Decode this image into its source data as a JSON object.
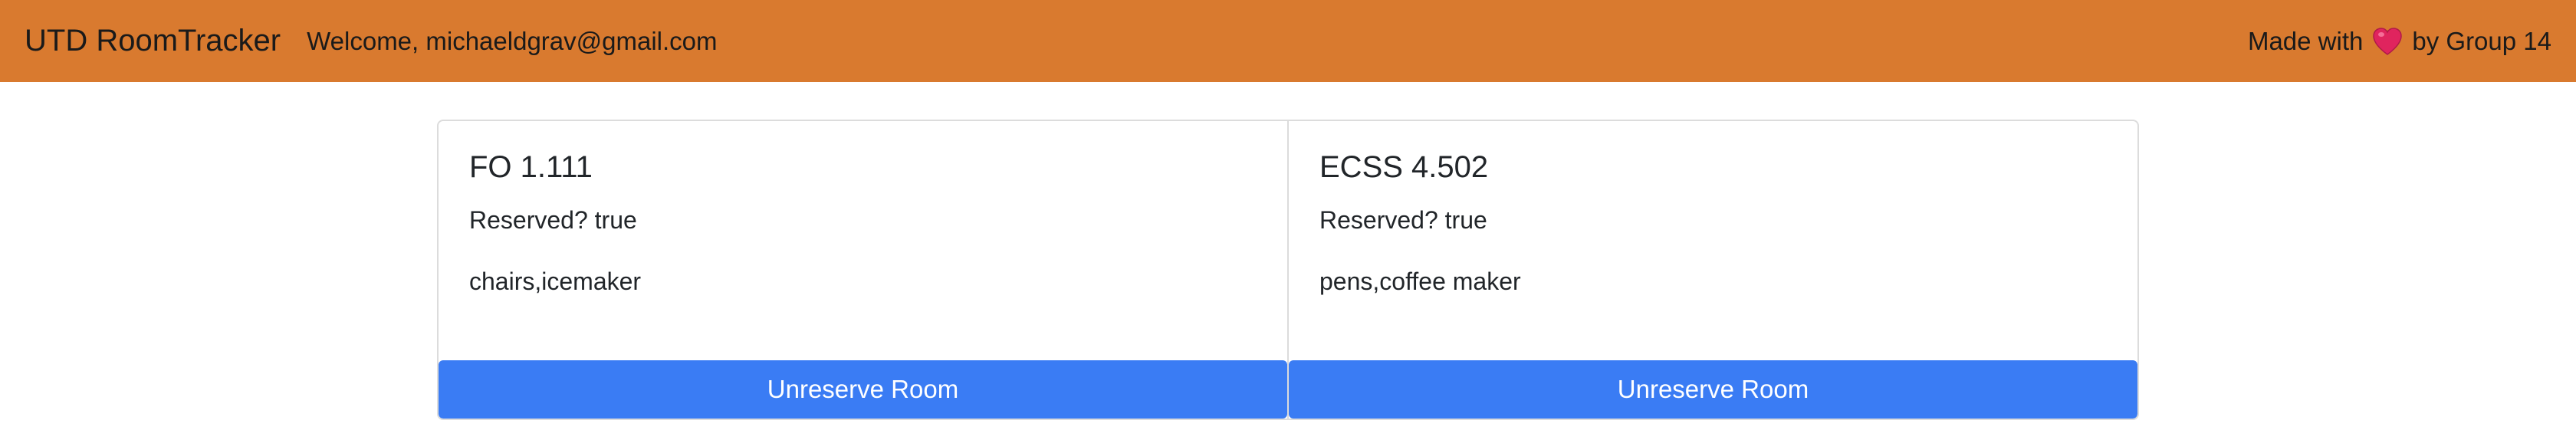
{
  "navbar": {
    "brand": "UTD RoomTracker",
    "welcome": "Welcome, michaeldgrav@gmail.com",
    "made_with_prefix": "Made with",
    "heart_icon": "heart-icon",
    "made_with_suffix": "by Group 14",
    "background_color": "#d97a2f"
  },
  "rooms": [
    {
      "title": "FO 1.111",
      "reserved_text": "Reserved? true",
      "amenities": "chairs,icemaker",
      "button_label": "Unreserve Room"
    },
    {
      "title": "ECSS 4.502",
      "reserved_text": "Reserved? true",
      "amenities": "pens,coffee maker",
      "button_label": "Unreserve Room"
    }
  ],
  "colors": {
    "button": "#3a7cf4",
    "heart": "#e0245e"
  }
}
